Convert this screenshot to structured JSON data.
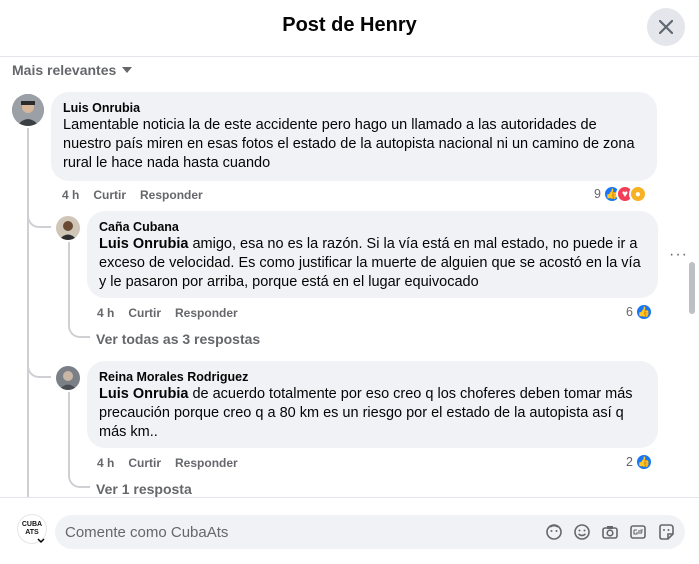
{
  "header": {
    "title": "Post de Henry"
  },
  "sort": {
    "label": "Mais relevantes"
  },
  "comments": [
    {
      "author": "Luis Onrubia",
      "text": "Lamentable noticia la de este accidente pero hago un llamado a las autoridades de nuestro país miren en esas fotos el estado de la autopista nacional ni un camino de zona rural le hace nada hasta cuando",
      "time": "4 h",
      "like_label": "Curtir",
      "reply_label": "Responder",
      "reactions": "9"
    },
    {
      "author": "Caña Cubana",
      "mention": "Luis Onrubia",
      "text": " amigo, esa no es la razón. Si la vía está en mal estado, no puede ir a exceso de velocidad. Es como justificar la muerte de alguien que se acostó en la vía y le pasaron por arriba, porque está en el lugar equivocado",
      "time": "4 h",
      "like_label": "Curtir",
      "reply_label": "Responder",
      "reactions": "6",
      "more_replies": "Ver todas as 3 respostas"
    },
    {
      "author": "Reina Morales Rodriguez",
      "mention": "Luis Onrubia",
      "text": " de acuerdo totalmente por eso creo q los choferes deben tomar más precaución porque creo q a 80 km es un riesgo por el estado de la autopista así q más km..",
      "time": "4 h",
      "like_label": "Curtir",
      "reply_label": "Responder",
      "reactions": "2",
      "more_replies": "Ver 1 resposta"
    }
  ],
  "composer": {
    "avatar_text": "CUBA ATS",
    "placeholder": "Comente como CubaAts"
  },
  "colors": {
    "accent": "#1877f2",
    "bubble": "#f0f2f5",
    "muted": "#65676b"
  }
}
